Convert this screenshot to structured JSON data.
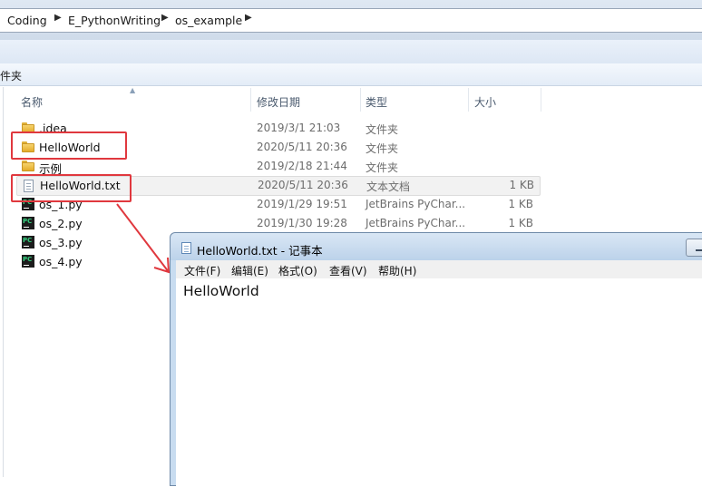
{
  "breadcrumb": {
    "items": [
      "Coding",
      "E_PythonWriting",
      "os_example"
    ]
  },
  "toolbar": {
    "partial_label": "件夹"
  },
  "columns": {
    "name": "名称",
    "modified": "修改日期",
    "type": "类型",
    "size": "大小"
  },
  "files": [
    {
      "name": ".idea",
      "modified": "2019/3/1 21:03",
      "type": "文件夹",
      "size": "",
      "icon": "folder-icon"
    },
    {
      "name": "HelloWorld",
      "modified": "2020/5/11 20:36",
      "type": "文件夹",
      "size": "",
      "icon": "folder-icon"
    },
    {
      "name": "示例",
      "modified": "2019/2/18 21:44",
      "type": "文件夹",
      "size": "",
      "icon": "folder-icon"
    },
    {
      "name": "HelloWorld.txt",
      "modified": "2020/5/11 20:36",
      "type": "文本文档",
      "size": "1 KB",
      "icon": "text-file-icon"
    },
    {
      "name": "os_1.py",
      "modified": "2019/1/29 19:51",
      "type": "JetBrains PyChar...",
      "size": "1 KB",
      "icon": "pycharm-file-icon"
    },
    {
      "name": "os_2.py",
      "modified": "2019/1/30 19:28",
      "type": "JetBrains PyChar...",
      "size": "1 KB",
      "icon": "pycharm-file-icon"
    },
    {
      "name": "os_3.py",
      "modified": "",
      "type": "",
      "size": "",
      "icon": "pycharm-file-icon"
    },
    {
      "name": "os_4.py",
      "modified": "",
      "type": "",
      "size": "",
      "icon": "pycharm-file-icon"
    }
  ],
  "notepad": {
    "title": "HelloWorld.txt - 记事本",
    "menu": [
      "文件(F)",
      "编辑(E)",
      "格式(O)",
      "查看(V)",
      "帮助(H)"
    ],
    "content": "HelloWorld"
  },
  "colors": {
    "highlight_box": "#e0383e",
    "arrow": "#e0383e"
  }
}
